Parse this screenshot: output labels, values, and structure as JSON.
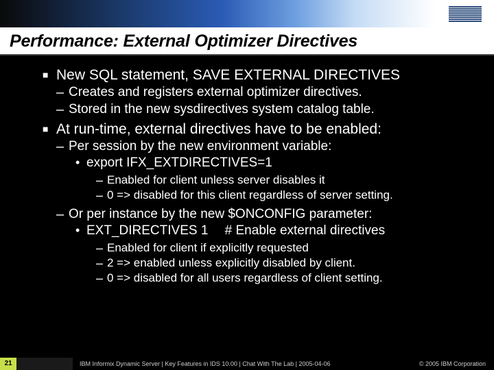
{
  "logo": {
    "name": "IBM"
  },
  "title": "Performance: External Optimizer Directives",
  "bullets": {
    "b1": "New SQL statement, SAVE EXTERNAL DIRECTIVES",
    "b1a": "Creates and registers external optimizer directives.",
    "b1b": "Stored in the new sysdirectives system catalog table.",
    "b2": "At run-time, external directives have to be enabled:",
    "b2a": "Per session by the new environment variable:",
    "b2a1": "export IFX_EXTDIRECTIVES=1",
    "b2a1x": "Enabled for client unless server disables it",
    "b2a1y": "0 => disabled for this client regardless of server setting.",
    "b2b": "Or per instance by the new $ONCONFIG parameter:",
    "b2b1": "EXT_DIRECTIVES 1  # Enable external directives",
    "b2b1x": "Enabled for client if explicitly requested",
    "b2b1y": "2 => enabled unless explicitly disabled by client.",
    "b2b1z": "0 => disabled for all users regardless of client setting."
  },
  "footer": {
    "page": "21",
    "text": "IBM Informix Dynamic Server | Key Features in IDS 10.00 | Chat With The Lab | 2005-04-06",
    "copyright": "© 2005 IBM Corporation"
  }
}
